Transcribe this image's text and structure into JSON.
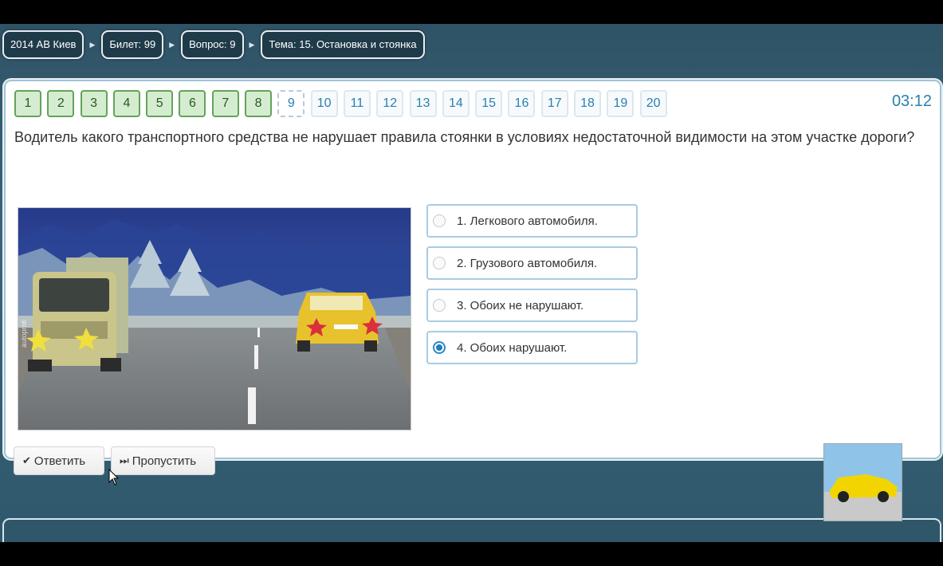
{
  "breadcrumbs": {
    "exam": "2014 АВ Киев",
    "ticket": "Билет: 99",
    "question": "Вопрос: 9",
    "topic": "Тема: 15. Остановка и стоянка"
  },
  "navigation": {
    "numbers": [
      "1",
      "2",
      "3",
      "4",
      "5",
      "6",
      "7",
      "8",
      "9",
      "10",
      "11",
      "12",
      "13",
      "14",
      "15",
      "16",
      "17",
      "18",
      "19",
      "20"
    ],
    "answered_count": 8,
    "current_index": 9,
    "colors": {
      "answered_fill": "#d5ecd0",
      "answered_border": "#63a45a",
      "pending_text": "#2a7fb0"
    }
  },
  "timer": "03:12",
  "question_text": "Водитель какого транспортного средства не нарушает правила стоянки в условиях недостаточной видимости на этом участке дороги?",
  "illustration": {
    "subject": "truck and car parked at roadside in fog",
    "watermark": "autoprofi"
  },
  "answers": [
    {
      "label": "1. Легкового автомобиля.",
      "selected": false
    },
    {
      "label": "2. Грузового автомобиля.",
      "selected": false
    },
    {
      "label": "3. Обоих не нарушают.",
      "selected": false
    },
    {
      "label": "4. Обоих нарушают.",
      "selected": true
    }
  ],
  "buttons": {
    "answer_label": "Ответить",
    "answer_icon": "check-icon",
    "skip_label": "Пропустить",
    "skip_icon": "skip-forward-icon"
  }
}
